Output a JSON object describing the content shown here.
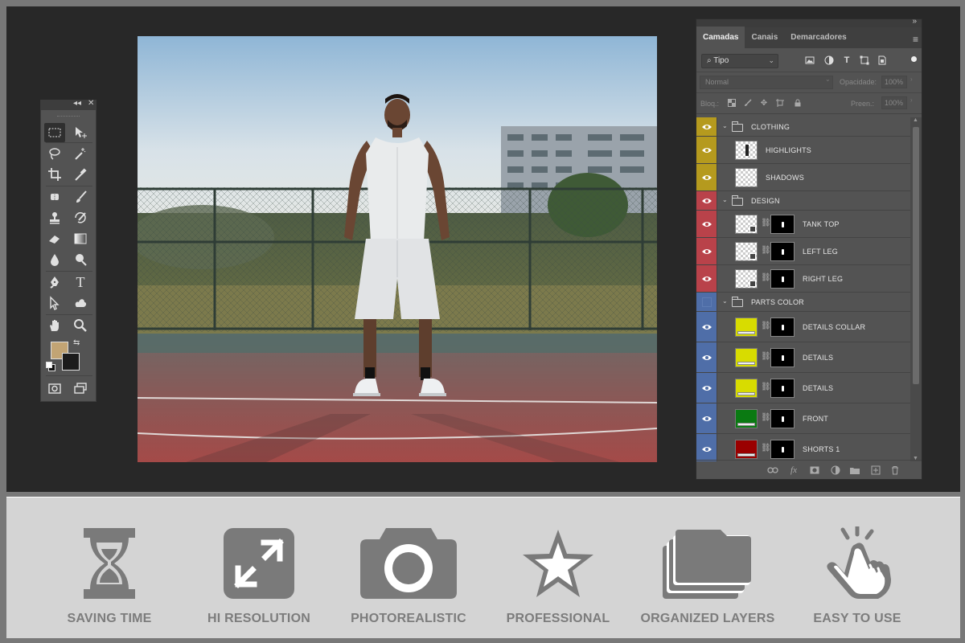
{
  "colors": {
    "workspace_bg": "#282828",
    "panel_bg": "#535353",
    "group_clothing": "#b59a1e",
    "group_design": "#b9424a",
    "group_parts_color": "#4f6ea8",
    "foreground_color": "#c2a474",
    "background_color": "#1c1c1c",
    "feature_icon": "#7a7a7a",
    "feature_strip_bg": "#d4d4d4"
  },
  "toolbox": {
    "collapse_glyph": "◂◂",
    "close_glyph": "✕",
    "tools": [
      {
        "name": "rectangular-marquee-icon",
        "active": true
      },
      {
        "name": "move-tool-icon"
      },
      {
        "name": "lasso-icon"
      },
      {
        "name": "magic-wand-icon"
      },
      {
        "name": "crop-icon"
      },
      {
        "name": "eyedropper-icon"
      },
      {
        "name": "spot-healing-icon"
      },
      {
        "name": "brush-icon"
      },
      {
        "name": "clone-stamp-icon"
      },
      {
        "name": "history-brush-icon"
      },
      {
        "name": "eraser-icon"
      },
      {
        "name": "gradient-icon"
      },
      {
        "name": "blur-icon"
      },
      {
        "name": "dodge-icon"
      },
      {
        "name": "pen-icon"
      },
      {
        "name": "type-icon",
        "glyph": "T"
      },
      {
        "name": "path-selection-icon"
      },
      {
        "name": "custom-shape-icon"
      },
      {
        "name": "hand-icon"
      },
      {
        "name": "zoom-icon"
      },
      {
        "name": "quick-mask-icon"
      },
      {
        "name": "screen-mode-icon"
      }
    ]
  },
  "layers_panel": {
    "collapse_glyph": "»",
    "menu_glyph": "≡",
    "tabs": [
      {
        "label": "Camadas",
        "active": true
      },
      {
        "label": "Canais"
      },
      {
        "label": "Demarcadores"
      }
    ],
    "filter": {
      "value": "Tipo",
      "icons": [
        "image-filter-icon",
        "adjustment-filter-icon",
        "type-filter-icon",
        "shape-filter-icon",
        "smart-object-filter-icon"
      ]
    },
    "blend_mode": "Normal",
    "opacity_label": "Opacidade:",
    "opacity_value": "100%",
    "lock_label": "Bloq.:",
    "lock_icons": [
      "lock-pixels-icon",
      "lock-paint-icon",
      "lock-position-icon",
      "lock-artboard-icon",
      "lock-all-icon"
    ],
    "fill_label": "Preen.:",
    "fill_value": "100%",
    "layers": [
      {
        "name": "CLOTHING",
        "type": "group",
        "group": "clothing",
        "visible": true
      },
      {
        "name": "HIGHLIGHTS",
        "type": "layer",
        "group": "clothing",
        "visible": true,
        "thumb": "transparent-figure"
      },
      {
        "name": "SHADOWS",
        "type": "layer",
        "group": "clothing",
        "visible": true,
        "thumb": "transparent"
      },
      {
        "name": "DESIGN",
        "type": "group",
        "group": "design",
        "visible": true
      },
      {
        "name": "TANK TOP",
        "type": "layer",
        "group": "design",
        "visible": true,
        "thumb": "smart",
        "mask": true
      },
      {
        "name": "LEFT LEG",
        "type": "layer",
        "group": "design",
        "visible": true,
        "thumb": "smart",
        "mask": true
      },
      {
        "name": "RIGHT LEG",
        "type": "layer",
        "group": "design",
        "visible": true,
        "thumb": "smart",
        "mask": true
      },
      {
        "name": "PARTS COLOR",
        "type": "group",
        "group": "parts_color",
        "visible": false
      },
      {
        "name": "DETAILS COLLAR",
        "type": "fill",
        "group": "parts_color",
        "visible": true,
        "fill": "#d8dc00",
        "mask": true
      },
      {
        "name": "DETAILS",
        "type": "fill",
        "group": "parts_color",
        "visible": true,
        "fill": "#d8dc00",
        "mask": true
      },
      {
        "name": "DETAILS",
        "type": "fill",
        "group": "parts_color",
        "visible": true,
        "fill": "#d8dc00",
        "mask": true
      },
      {
        "name": "FRONT",
        "type": "fill",
        "group": "parts_color",
        "visible": true,
        "fill": "#0a7a12",
        "mask": true
      },
      {
        "name": "SHORTS 1",
        "type": "fill",
        "group": "parts_color",
        "visible": true,
        "fill": "#9a0000",
        "mask": true
      }
    ],
    "bottom_icons": [
      "link-layers-icon",
      "fx-icon",
      "add-mask-icon",
      "adjustment-layer-icon",
      "new-group-icon",
      "new-layer-icon",
      "trash-icon"
    ]
  },
  "features": [
    {
      "label": "SAVING TIME",
      "icon": "hourglass-icon"
    },
    {
      "label": "HI RESOLUTION",
      "icon": "expand-arrows-icon"
    },
    {
      "label": "PHOTOREALISTIC",
      "icon": "camera-icon"
    },
    {
      "label": "PROFESSIONAL",
      "icon": "star-icon"
    },
    {
      "label": "ORGANIZED LAYERS",
      "icon": "stacked-folders-icon"
    },
    {
      "label": "EASY TO USE",
      "icon": "tap-hand-icon"
    }
  ]
}
